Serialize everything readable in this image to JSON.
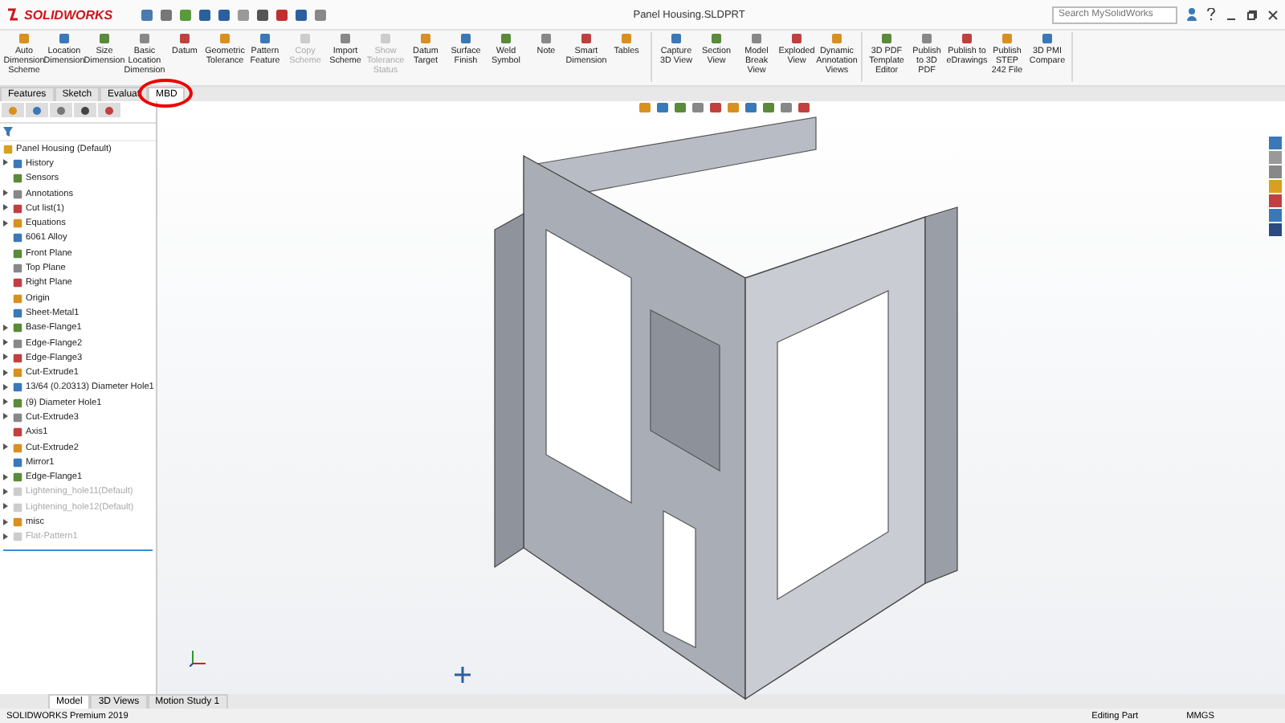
{
  "title_bar": {
    "app_name": "SOLIDWORKS",
    "document_title": "Panel Housing.SLDPRT",
    "search": {
      "placeholder": "Search MySolidWorks"
    }
  },
  "ribbon": {
    "groups": [
      {
        "tools": [
          {
            "label": "Auto Dimension Scheme",
            "disabled": false
          },
          {
            "label": "Location Dimension",
            "disabled": false
          },
          {
            "label": "Size Dimension",
            "disabled": false
          },
          {
            "label": "Basic Location Dimension",
            "disabled": false
          },
          {
            "label": "Datum",
            "disabled": false
          },
          {
            "label": "Geometric Tolerance",
            "disabled": false
          },
          {
            "label": "Pattern Feature",
            "disabled": false
          },
          {
            "label": "Copy Scheme",
            "disabled": true
          },
          {
            "label": "Import Scheme",
            "disabled": false
          },
          {
            "label": "Show Tolerance Status",
            "disabled": true
          },
          {
            "label": "Datum Target",
            "disabled": false
          },
          {
            "label": "Surface Finish",
            "disabled": false
          },
          {
            "label": "Weld Symbol",
            "disabled": false
          },
          {
            "label": "Note",
            "disabled": false
          },
          {
            "label": "Smart Dimension",
            "disabled": false
          },
          {
            "label": "Tables",
            "disabled": false
          }
        ]
      },
      {
        "tools": [
          {
            "label": "Capture 3D View",
            "disabled": false
          },
          {
            "label": "Section View",
            "disabled": false
          },
          {
            "label": "Model Break View",
            "disabled": false
          },
          {
            "label": "Exploded View",
            "disabled": false
          },
          {
            "label": "Dynamic Annotation Views",
            "disabled": false
          }
        ]
      },
      {
        "tools": [
          {
            "label": "3D PDF Template Editor",
            "disabled": false
          },
          {
            "label": "Publish to 3D PDF",
            "disabled": false
          },
          {
            "label": "Publish to eDrawings",
            "disabled": false
          },
          {
            "label": "Publish STEP 242 File",
            "disabled": false
          },
          {
            "label": "3D PMI Compare",
            "disabled": false
          }
        ]
      }
    ]
  },
  "command_tabs": [
    {
      "label": "Features",
      "selected": false
    },
    {
      "label": "Sketch",
      "selected": false
    },
    {
      "label": "Evaluat",
      "selected": false
    },
    {
      "label": "MBD",
      "selected": true
    }
  ],
  "feature_tree": {
    "root": "Panel Housing  (Default)",
    "children": [
      {
        "label": "History",
        "expander": true,
        "suppressed": false
      },
      {
        "label": "Sensors",
        "expander": false,
        "suppressed": false
      },
      {
        "label": "Annotations",
        "expander": true,
        "suppressed": false
      },
      {
        "label": "Cut list(1)",
        "expander": true,
        "suppressed": false
      },
      {
        "label": "Equations",
        "expander": true,
        "suppressed": false
      },
      {
        "label": "6061 Alloy",
        "expander": false,
        "suppressed": false
      },
      {
        "label": "Front Plane",
        "expander": false,
        "suppressed": false
      },
      {
        "label": "Top Plane",
        "expander": false,
        "suppressed": false
      },
      {
        "label": "Right Plane",
        "expander": false,
        "suppressed": false
      },
      {
        "label": "Origin",
        "expander": false,
        "suppressed": false
      },
      {
        "label": "Sheet-Metal1",
        "expander": false,
        "suppressed": false
      },
      {
        "label": "Base-Flange1",
        "expander": true,
        "suppressed": false
      },
      {
        "label": "Edge-Flange2",
        "expander": true,
        "suppressed": false
      },
      {
        "label": "Edge-Flange3",
        "expander": true,
        "suppressed": false
      },
      {
        "label": "Cut-Extrude1",
        "expander": true,
        "suppressed": false
      },
      {
        "label": "13/64 (0.20313) Diameter Hole1",
        "expander": true,
        "suppressed": false
      },
      {
        "label": "(9) Diameter Hole1",
        "expander": true,
        "suppressed": false
      },
      {
        "label": "Cut-Extrude3",
        "expander": true,
        "suppressed": false
      },
      {
        "label": "Axis1",
        "expander": false,
        "suppressed": false
      },
      {
        "label": "Cut-Extrude2",
        "expander": true,
        "suppressed": false
      },
      {
        "label": "Mirror1",
        "expander": false,
        "suppressed": false
      },
      {
        "label": "Edge-Flange1",
        "expander": true,
        "suppressed": false
      },
      {
        "label": "Lightening_hole11(Default)",
        "expander": true,
        "suppressed": true
      },
      {
        "label": "Lightening_hole12(Default)",
        "expander": true,
        "suppressed": true
      },
      {
        "label": "misc",
        "expander": true,
        "suppressed": false
      },
      {
        "label": "Flat-Pattern1",
        "expander": true,
        "suppressed": true
      }
    ]
  },
  "bottom_tabs": [
    {
      "label": "Model",
      "selected": true
    },
    {
      "label": "3D Views",
      "selected": false
    },
    {
      "label": "Motion Study 1",
      "selected": false
    }
  ],
  "status_bar": {
    "product": "SOLIDWORKS Premium 2019",
    "mode": "Editing Part",
    "units": "MMGS"
  }
}
